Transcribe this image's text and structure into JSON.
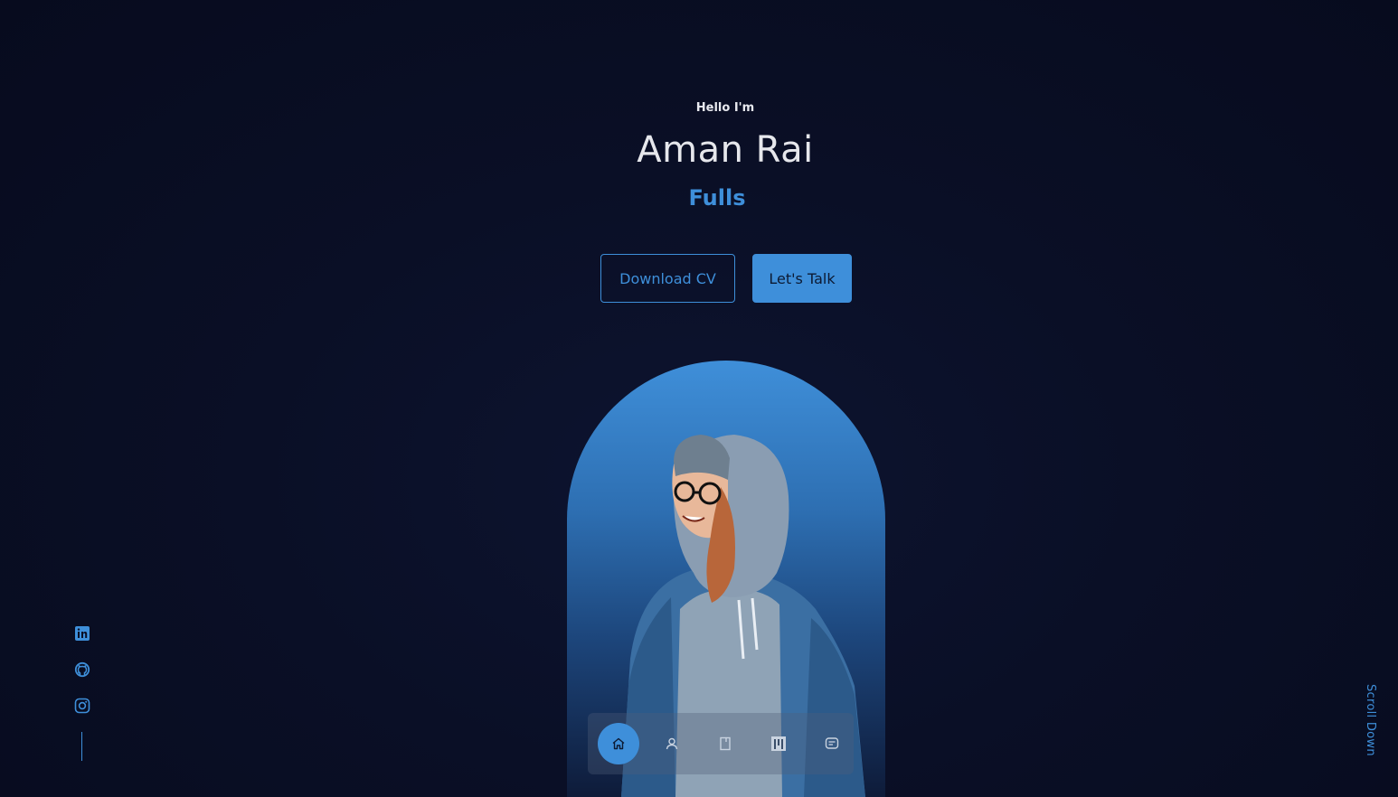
{
  "hero": {
    "greeting": "Hello I'm",
    "name": "Aman Rai",
    "role": "Fulls"
  },
  "buttons": {
    "download_cv": "Download CV",
    "lets_talk": "Let's Talk"
  },
  "colors": {
    "accent": "#3e8fda",
    "background": "#0a0f26",
    "text": "#e6e8ee"
  },
  "nav": {
    "items": [
      {
        "icon": "home-icon",
        "active": true
      },
      {
        "icon": "user-icon",
        "active": false
      },
      {
        "icon": "book-icon",
        "active": false
      },
      {
        "icon": "portfolio-icon",
        "active": false
      },
      {
        "icon": "message-icon",
        "active": false
      }
    ]
  },
  "socials": {
    "items": [
      {
        "icon": "linkedin-icon"
      },
      {
        "icon": "github-icon"
      },
      {
        "icon": "instagram-icon"
      }
    ]
  },
  "scroll": {
    "label": "Scroll Down"
  }
}
